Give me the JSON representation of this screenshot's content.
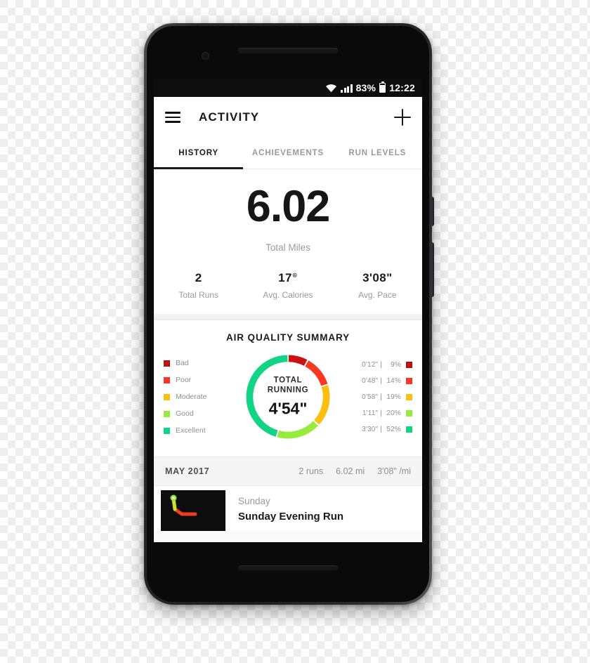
{
  "status_bar": {
    "wifi_icon": "wifi-icon",
    "signal_icon": "signal-bars-icon",
    "battery_percent": "83%",
    "battery_icon": "battery-icon",
    "time": "12:22"
  },
  "app_bar": {
    "menu_icon": "hamburger-menu-icon",
    "title": "ACTIVITY",
    "add_icon": "plus-icon"
  },
  "tabs": [
    {
      "label": "HISTORY",
      "active": true
    },
    {
      "label": "ACHIEVEMENTS",
      "active": false
    },
    {
      "label": "RUN LEVELS",
      "active": false
    }
  ],
  "summary": {
    "total_miles_value": "6.02",
    "total_miles_label": "Total Miles",
    "stats": [
      {
        "value": "2",
        "sup": "",
        "label": "Total Runs"
      },
      {
        "value": "17",
        "sup": "⊛",
        "label": "Avg. Calories"
      },
      {
        "value": "3'08\"",
        "sup": "",
        "label": "Avg. Pace"
      }
    ]
  },
  "air_quality": {
    "title": "AIR QUALITY SUMMARY",
    "center_line1": "TOTAL",
    "center_line2": "RUNNING",
    "center_value": "4'54\"",
    "legend": [
      {
        "label": "Bad",
        "color": "#cc1111",
        "time": "0'12\"",
        "percent": "9%",
        "value": 9
      },
      {
        "label": "Poor",
        "color": "#f93822",
        "time": "0'48\"",
        "percent": "14%",
        "value": 14
      },
      {
        "label": "Moderate",
        "color": "#fcbe11",
        "time": "0'58\"",
        "percent": "19%",
        "value": 19
      },
      {
        "label": "Good",
        "color": "#97eb3c",
        "time": "1'11\"",
        "percent": "20%",
        "value": 20
      },
      {
        "label": "Excellent",
        "color": "#13d486",
        "time": "3'30\"",
        "percent": "52%",
        "value": 52
      }
    ]
  },
  "chart_data": {
    "type": "pie",
    "title": "AIR QUALITY SUMMARY",
    "categories": [
      "Bad",
      "Poor",
      "Moderate",
      "Good",
      "Excellent"
    ],
    "values": [
      9,
      14,
      19,
      20,
      52
    ],
    "durations": [
      "0'12\"",
      "0'48\"",
      "0'58\"",
      "1'11\"",
      "3'30\""
    ],
    "colors": [
      "#cc1111",
      "#f93822",
      "#fcbe11",
      "#97eb3c",
      "#13d486"
    ],
    "center_label": "TOTAL RUNNING",
    "center_value": "4'54\"",
    "legend_position": "left-and-right",
    "grid": false
  },
  "month_section": {
    "month_label": "MAY 2017",
    "stats": [
      "2 runs",
      "6.02 mi",
      "3'08\" /mi"
    ]
  },
  "runs": [
    {
      "day": "Sunday",
      "name": "Sunday Evening Run",
      "thumb_icon": "route-map-thumbnail"
    }
  ]
}
